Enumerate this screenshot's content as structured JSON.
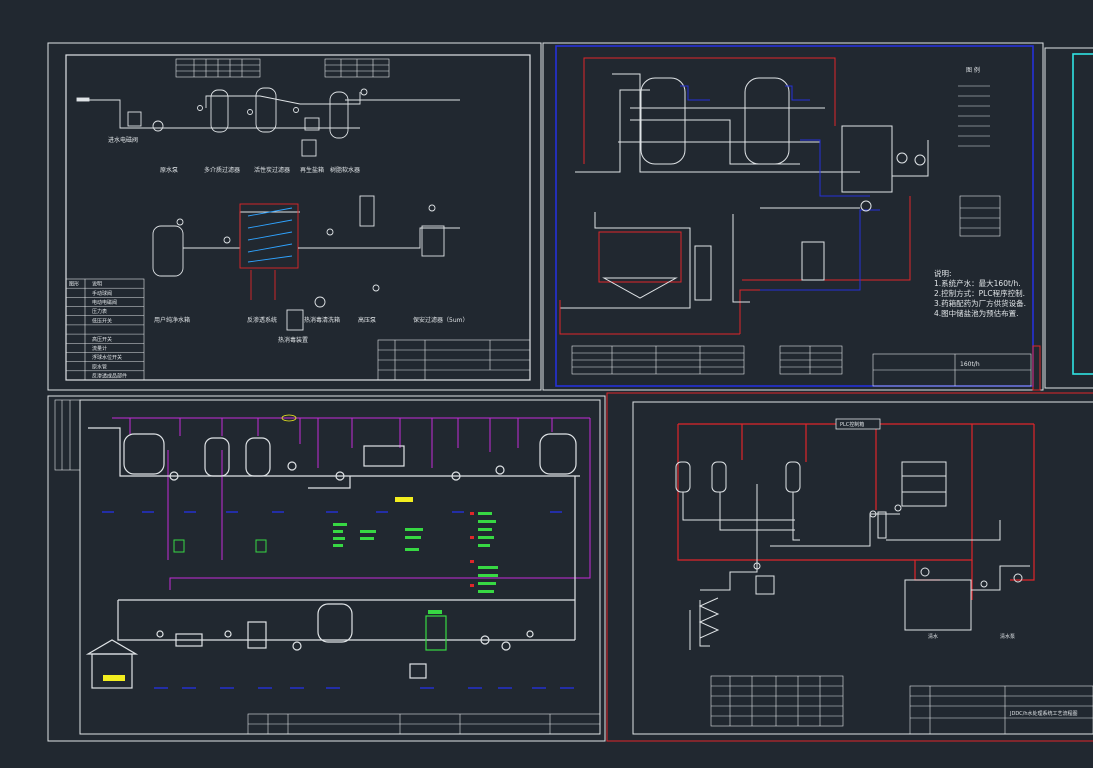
{
  "sheet_a": {
    "captions_row1": [
      "原水泵",
      "多介质过滤器",
      "活性炭过滤器",
      "再生盐箱",
      "树脂软水器"
    ],
    "caption_valve": "进水电磁阀",
    "captions_row2": [
      "用户纯净水箱",
      "反渗透系统",
      "热消毒清洗箱",
      "高压泵",
      "保安过滤器（5um）"
    ],
    "caption_heater": "热消毒装置",
    "legend_header": [
      "图形",
      "说明"
    ],
    "legend_items": [
      "手动球阀",
      "电动电磁阀",
      "压力表",
      "低压开关",
      "",
      "高压开关",
      "流量计",
      "浮球水位开关",
      "原水管",
      "反渗透成品部件"
    ]
  },
  "sheet_b": {
    "legend_title": "图 例",
    "notes_title": "说明:",
    "notes": [
      "1.系统产水：最大160t/h.",
      "2.控制方式：PLC程序控制.",
      "3.药箱配药为厂方供货设备.",
      "4.图中储盐池为预估布置."
    ],
    "title_block": "160t/h"
  },
  "sheet_d": {
    "plc_label": "PLC控制箱",
    "tank_label": "清水",
    "pump_label": "清水泵",
    "title_block": "JDDC/h水处理系统工艺流程图"
  },
  "colors": {
    "background": "#212830",
    "line": "#dfe3e6",
    "red": "#e0262a",
    "blue": "#2531d9",
    "magenta": "#c22bd8",
    "green": "#37d843",
    "yellow": "#f3ee1f",
    "cyan": "#2fe3e3"
  }
}
